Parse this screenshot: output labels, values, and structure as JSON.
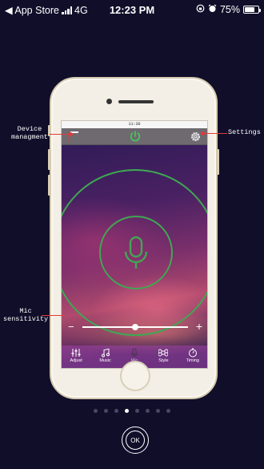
{
  "status_bar": {
    "back_app": "◀ App Store",
    "network": "4G",
    "time": "12:23 PM",
    "battery": "75%",
    "battery_level": 0.75
  },
  "device": {
    "mini_status_time": "11:36"
  },
  "callouts": {
    "device_management": "Device\nmanagment",
    "settings": "Settings",
    "mic_sensitivity": "Mic\nsensitivity"
  },
  "mic_sensitivity_level": 0.5,
  "tabs": [
    {
      "label": "Adjust",
      "icon": "sliders-icon"
    },
    {
      "label": "Music",
      "icon": "music-note-icon"
    },
    {
      "label": "Mic",
      "icon": "mic-icon"
    },
    {
      "label": "Style",
      "icon": "command-icon"
    },
    {
      "label": "Timing",
      "icon": "timer-icon"
    }
  ],
  "page_indicator": {
    "total": 8,
    "active": 3
  },
  "ok_button": "OK",
  "colors": {
    "background": "#100e29",
    "accent_green": "#3fa752",
    "callout_red": "#e23b3b"
  }
}
